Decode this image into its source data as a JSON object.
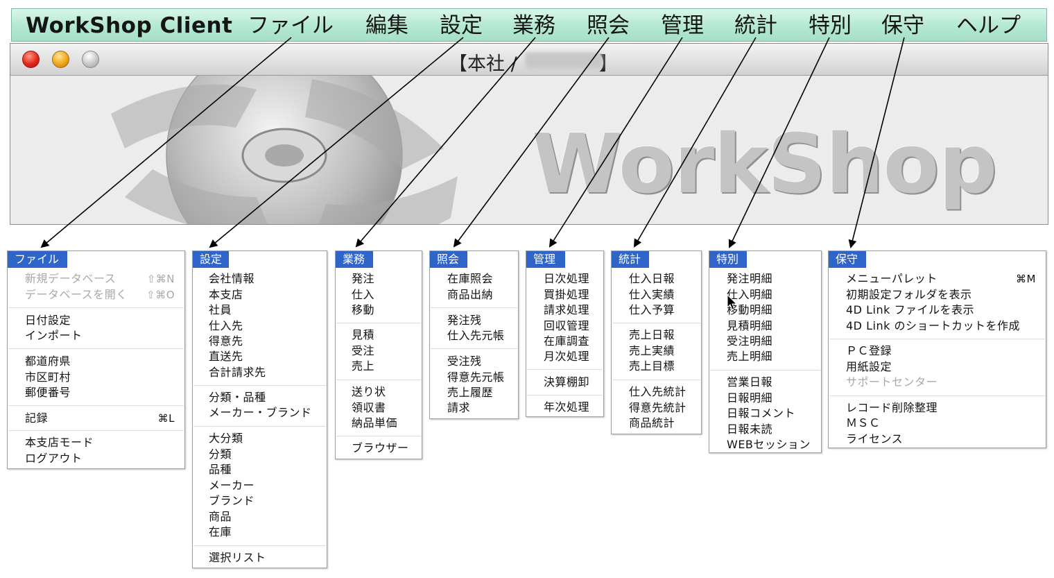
{
  "menubar": {
    "app_name": "WorkShop Client",
    "items": [
      "ファイル",
      "編集",
      "設定",
      "業務",
      "照会",
      "管理",
      "統計",
      "特別",
      "保守",
      "ヘルプ"
    ]
  },
  "window": {
    "title": "【本社 /",
    "title_end": "】",
    "brand": "WorkShop"
  },
  "menus": {
    "file": {
      "title": "ファイル",
      "items": [
        {
          "label": "新規データベース",
          "shortcut": "⇧⌘N",
          "disabled": true
        },
        {
          "label": "データベースを開く",
          "shortcut": "⇧⌘O",
          "disabled": true
        },
        {
          "label": "日付設定"
        },
        {
          "label": "インポート"
        },
        {
          "label": "都道府県"
        },
        {
          "label": "市区町村"
        },
        {
          "label": "郵便番号"
        },
        {
          "label": "記録",
          "shortcut": "⌘L"
        },
        {
          "label": "本支店モード"
        },
        {
          "label": "ログアウト"
        }
      ]
    },
    "settings": {
      "title": "設定",
      "items": [
        "会社情報",
        "本支店",
        "社員",
        "仕入先",
        "得意先",
        "直送先",
        "合計請求先",
        "分類・品種",
        "メーカー・ブランド",
        "大分類",
        "分類",
        "品種",
        "メーカー",
        "ブランド",
        "商品",
        "在庫",
        "選択リスト"
      ]
    },
    "business": {
      "title": "業務",
      "items": [
        "発注",
        "仕入",
        "移動",
        "見積",
        "受注",
        "売上",
        "送り状",
        "領収書",
        "納品単価",
        "ブラウザー"
      ]
    },
    "inquiry": {
      "title": "照会",
      "items": [
        "在庫照会",
        "商品出納",
        "発注残",
        "仕入先元帳",
        "受注残",
        "得意先元帳",
        "売上履歴",
        "請求"
      ]
    },
    "management": {
      "title": "管理",
      "items": [
        "日次処理",
        "買掛処理",
        "請求処理",
        "回収管理",
        "在庫調査",
        "月次処理",
        "決算棚卸",
        "年次処理"
      ]
    },
    "statistics": {
      "title": "統計",
      "items": [
        "仕入日報",
        "仕入実績",
        "仕入予算",
        "売上日報",
        "売上実績",
        "売上目標",
        "仕入先統計",
        "得意先統計",
        "商品統計"
      ]
    },
    "special": {
      "title": "特別",
      "items": [
        "発注明細",
        "仕入明細",
        "移動明細",
        "見積明細",
        "受注明細",
        "売上明細",
        "営業日報",
        "日報明細",
        "日報コメント",
        "日報未読",
        "WEBセッション"
      ]
    },
    "maintenance": {
      "title": "保守",
      "items": [
        {
          "label": "メニューパレット",
          "shortcut": "⌘M"
        },
        {
          "label": "初期設定フォルダを表示"
        },
        {
          "label": "4D Link ファイルを表示"
        },
        {
          "label": "4D Link のショートカットを作成"
        },
        {
          "label": "ＰＣ登録"
        },
        {
          "label": "用紙設定"
        },
        {
          "label": "サポートセンター",
          "disabled": true
        },
        {
          "label": "レコード削除整理"
        },
        {
          "label": "ＭＳＣ"
        },
        {
          "label": "ライセンス"
        }
      ]
    }
  },
  "colors": {
    "menubar_bg": "#b3e8d2",
    "menu_title_bg": "#2f64c9",
    "disabled_text": "#a8a8a8"
  }
}
